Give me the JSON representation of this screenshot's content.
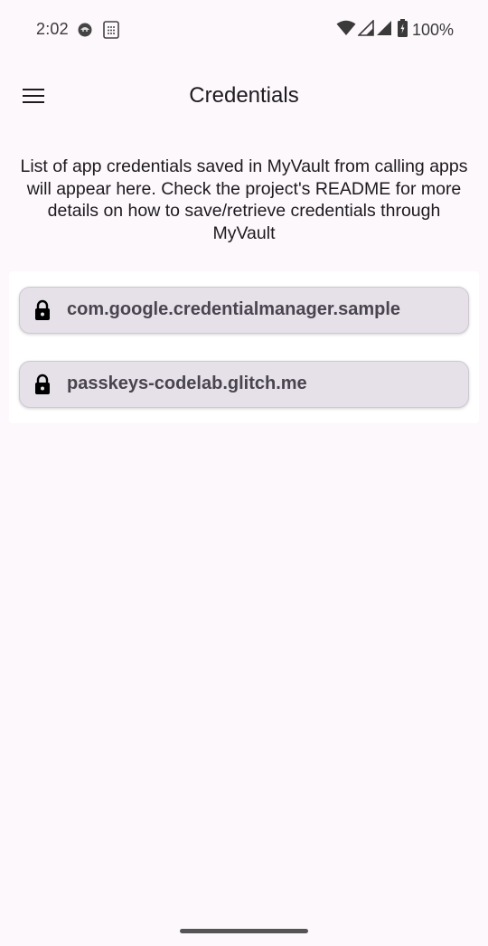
{
  "status_bar": {
    "time": "2:02",
    "battery_percent": "100%",
    "icons": [
      "face-icon",
      "sim-card-icon",
      "wifi-icon",
      "signal-icon",
      "signal-icon",
      "battery-icon"
    ]
  },
  "app_bar": {
    "title": "Credentials",
    "menu_icon": "hamburger-menu-icon"
  },
  "description": "List of app credentials saved in MyVault from calling apps will appear here. Check the project's README for more details on how to save/retrieve credentials through MyVault",
  "credentials": [
    {
      "label": "com.google.credentialmanager.sample",
      "icon": "lock-icon"
    },
    {
      "label": "passkeys-codelab.glitch.me",
      "icon": "lock-icon"
    }
  ],
  "colors": {
    "background": "#fdf8fc",
    "item_background": "#e6e0e9",
    "item_text": "#49454f"
  }
}
